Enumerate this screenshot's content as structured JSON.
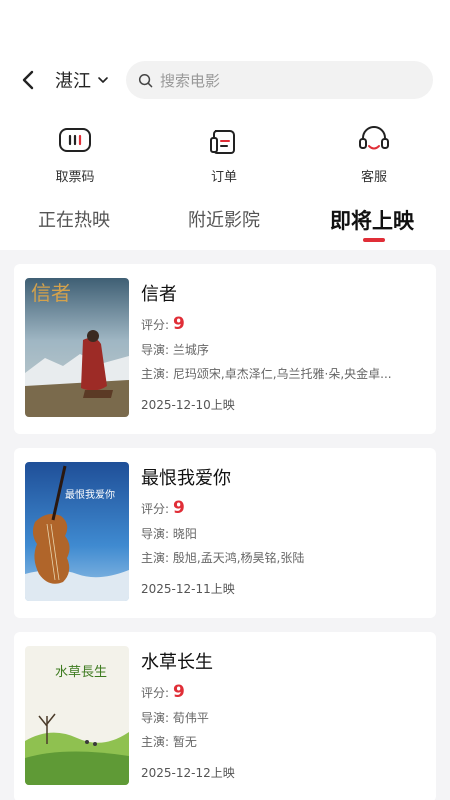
{
  "header": {
    "city": "湛江",
    "search_placeholder": "搜索电影"
  },
  "quick_actions": [
    {
      "label": "取票码",
      "icon": "ticket-code-icon"
    },
    {
      "label": "订单",
      "icon": "order-icon"
    },
    {
      "label": "客服",
      "icon": "headset-icon"
    }
  ],
  "tabs": [
    {
      "label": "正在热映",
      "active": false
    },
    {
      "label": "附近影院",
      "active": false
    },
    {
      "label": "即将上映",
      "active": true
    }
  ],
  "labels": {
    "score": "评分:",
    "director": "导演:",
    "cast": "主演:"
  },
  "movies": [
    {
      "title": "信者",
      "score": "9",
      "director": "兰城序",
      "cast": "尼玛颂宋,卓杰泽仁,乌兰托雅·朵,央金卓...",
      "release": "2025-12-10上映",
      "poster_text": "信者"
    },
    {
      "title": "最恨我爱你",
      "score": "9",
      "director": "晓阳",
      "cast": "殷旭,孟天鸿,杨昊铭,张陆",
      "release": "2025-12-11上映",
      "poster_text": "最恨我爱你"
    },
    {
      "title": "水草长生",
      "score": "9",
      "director": "荀伟平",
      "cast": "暂无",
      "release": "2025-12-12上映",
      "poster_text": "水草長生"
    }
  ],
  "colors": {
    "accent": "#e02e37",
    "list_bg": "#f4f4f6",
    "search_bg": "#f2f2f2"
  }
}
